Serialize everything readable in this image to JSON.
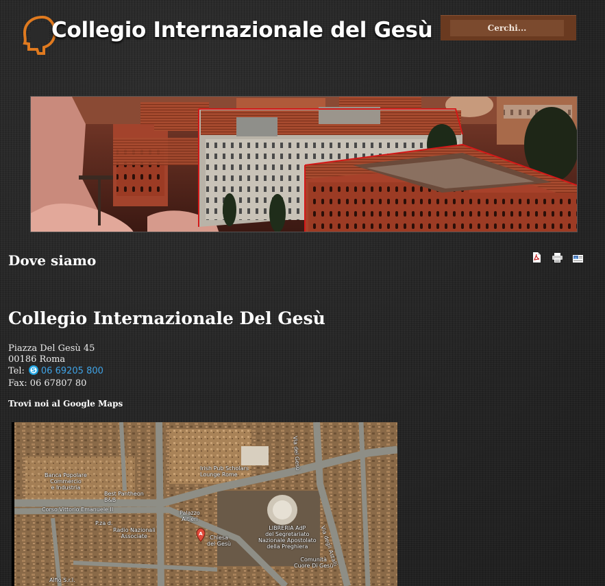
{
  "site": {
    "logo_text": "Collegio Internazionale del Gesù"
  },
  "search": {
    "placeholder": "Cerchi..."
  },
  "page": {
    "title": "Dove siamo",
    "heading": "Collegio Internazionale Del Gesù"
  },
  "toolbar": {
    "icons": [
      "pdf-icon",
      "print-icon",
      "email-icon"
    ]
  },
  "contact": {
    "street": "Piazza Del Gesù 45",
    "city": "00186 Roma",
    "tel_label": "Tel:",
    "phone": "06 69205 800",
    "fax": "Fax: 06 67807 80"
  },
  "maps": {
    "label": "Trovi noi al Google Maps",
    "places": {
      "irish_pub": "Irish Pub Scholars\nLounge Rome",
      "banca": "Banca Popolare\nCommercio\ne Industria",
      "best_pantheon": "Best Pantheon\nB&B",
      "corso": "Corso Vittorio Emanuele II",
      "piazza_gesu": "P.za d.",
      "radio": "Radio Nazionali\nAssociate",
      "palazzo": "Palazzo\nAltieri",
      "chiesa": "Chiesa\ndel Gesù",
      "libreria": "LIBRERIA AdP\ndel Segretariato\nNazionale Apostolato\ndella Preghiera",
      "comunita": "Comunità\nCuore Di Gesù",
      "via_astalli": "Via degli Astalli",
      "via_delfini": "Alfio S.r.l.",
      "via_gesu": "Via del Gesù"
    }
  },
  "colors": {
    "link": "#3fa3e6",
    "search_bg": "#6a3a20",
    "logo_orange": "#e07a1f"
  }
}
